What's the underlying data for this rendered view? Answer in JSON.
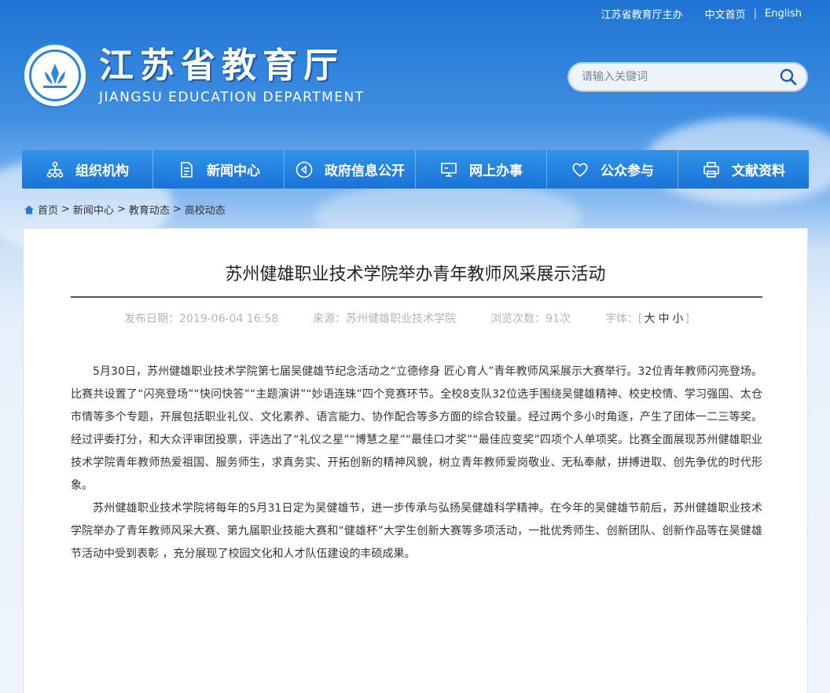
{
  "header": {
    "top_links": [
      "江苏省教育厅主办",
      "中文首页",
      "English"
    ],
    "logo_cn": "江苏省教育厅",
    "logo_en": "JIANGSU EDUCATION DEPARTMENT",
    "search_placeholder": "请输入关键词"
  },
  "nav": {
    "items": [
      {
        "label": "组织机构",
        "icon": "org-chart-icon"
      },
      {
        "label": "新闻中心",
        "icon": "document-icon"
      },
      {
        "label": "政府信息公开",
        "icon": "play-circle-icon"
      },
      {
        "label": "网上办事",
        "icon": "monitor-icon"
      },
      {
        "label": "公众参与",
        "icon": "heart-icon"
      },
      {
        "label": "文献资料",
        "icon": "printer-icon"
      }
    ]
  },
  "breadcrumb": {
    "items": [
      "首页",
      "新闻中心",
      "教育动态",
      "高校动态"
    ]
  },
  "article": {
    "title": "苏州健雄职业技术学院举办青年教师风采展示活动",
    "date": "发布日期：2019-06-04 16:58",
    "source": "来源：苏州健雄职业技术学院",
    "views": "浏览次数：91次",
    "font_label": "字体：",
    "font_sizes": [
      "大",
      "中",
      "小"
    ],
    "paragraphs": [
      "5月30日，苏州健雄职业技术学院第七届吴健雄节纪念活动之“立德修身 匠心育人”青年教师风采展示大赛举行。32位青年教师闪亮登场。比赛共设置了“闪亮登场”“快问快答”“主题演讲”“妙语连珠”四个竞赛环节。全校8支队32位选手围绕吴健雄精神、校史校情、学习强国、太仓市情等多个专题，开展包括职业礼仪、文化素养、语言能力、协作配合等多方面的综合较量。经过两个多小时角逐，产生了团体一二三等奖。经过评委打分，和大众评审团投票，评选出了“礼仪之星”“博慧之星”“最佳口才奖”“最佳应变奖”四项个人单项奖。比赛全面展现苏州健雄职业技术学院青年教师热爱祖国、服务师生，求真务实、开拓创新的精神风貌，树立青年教师爱岗敬业、无私奉献，拼搏进取、创先争优的时代形象。",
      "苏州健雄职业技术学院将每年的5月31日定为吴健雄节，进一步传承与弘扬吴健雄科学精神。在今年的吴健雄节前后，苏州健雄职业技术学院举办了青年教师风采大赛、第九届职业技能大赛和“健雄杯”大学生创新大赛等多项活动，一批优秀师生、创新团队、创新作品等在吴健雄节活动中受到表彰 ，充分展现了校园文化和人才队伍建设的丰硕成果。"
    ]
  }
}
